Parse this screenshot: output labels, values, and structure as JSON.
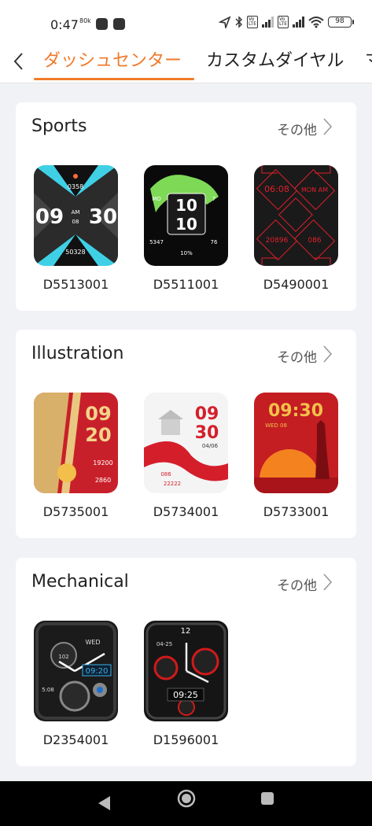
{
  "status": {
    "time": "0:47",
    "data_speed": "80k",
    "battery": "98"
  },
  "header": {
    "back_icon": "chevron-left-icon",
    "tabs": [
      {
        "label": "ダッシュセンター",
        "active": true
      },
      {
        "label": "カスタムダイヤル",
        "active": false
      },
      {
        "label": "マ",
        "active": false
      }
    ],
    "accent_color": "#f07a2a"
  },
  "sections": [
    {
      "title": "Sports",
      "more_label": "その他",
      "faces": [
        {
          "id": "D5513001",
          "hour": "09",
          "minute": "30",
          "steps": "0358",
          "distance": "50328",
          "ampm": "AM",
          "day": "08"
        },
        {
          "id": "D5511001",
          "time_top": "10",
          "time_bottom": "10",
          "left": "5347",
          "right": "76",
          "battery": "10%",
          "badge": "MO",
          "date": "7"
        },
        {
          "id": "D5490001",
          "time": "06:08",
          "ampm": "MON AM",
          "steps": "20896",
          "value": "086"
        }
      ]
    },
    {
      "title": "Illustration",
      "more_label": "その他",
      "faces": [
        {
          "id": "D5735001",
          "hour": "09",
          "minute": "20",
          "steps": "19200",
          "cal": "2860"
        },
        {
          "id": "D5734001",
          "hour": "09",
          "minute": "30",
          "date": "04/06",
          "heart": "086",
          "steps": "22222"
        },
        {
          "id": "D5733001",
          "time": "09:30",
          "date": "WED 08"
        }
      ]
    },
    {
      "title": "Mechanical",
      "more_label": "その他",
      "faces": [
        {
          "id": "D2354001",
          "day": "WED",
          "time": "09:20",
          "sub": "102",
          "date": "5:08"
        },
        {
          "id": "D1596001",
          "twelve": "12",
          "date": "04-25",
          "time": "09:25"
        }
      ]
    }
  ],
  "nav": {
    "back_icon": "triangle-back-icon",
    "home_icon": "circle-home-icon",
    "recent_icon": "square-recent-icon"
  }
}
